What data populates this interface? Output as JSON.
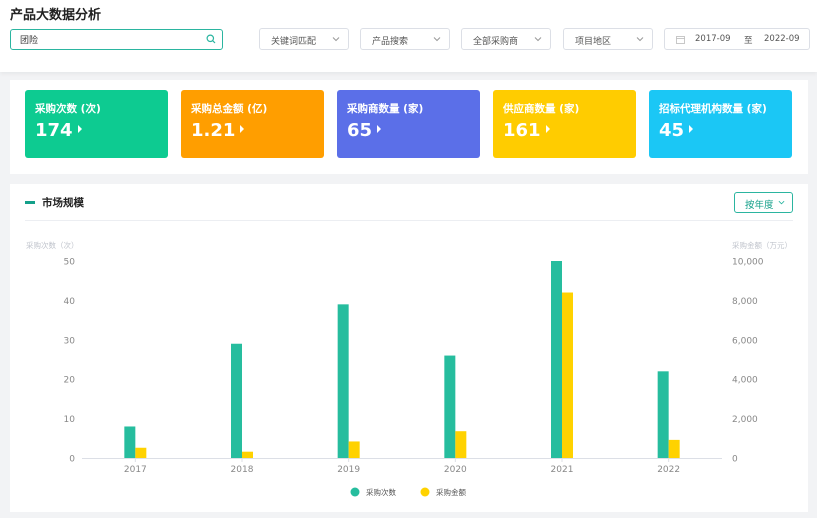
{
  "header": {
    "title": "产品大数据分析",
    "search": {
      "value": "团险",
      "placeholder": ""
    },
    "filters": [
      {
        "label": "关键词匹配"
      },
      {
        "label": "产品搜索"
      },
      {
        "label": "全部采购商"
      },
      {
        "label": "项目地区"
      }
    ],
    "date_range": {
      "start": "2017-09",
      "separator": "至",
      "end": "2022-09"
    }
  },
  "stats": [
    {
      "label": "采购次数 (次)",
      "value": "174",
      "color": "#0dcb91"
    },
    {
      "label": "采购总金额 (亿)",
      "value": "1.21",
      "color": "#ff9e00"
    },
    {
      "label": "采购商数量 (家)",
      "value": "65",
      "color": "#5b6fe8"
    },
    {
      "label": "供应商数量 (家)",
      "value": "161",
      "color": "#ffcc00"
    },
    {
      "label": "招标代理机构数量 (家)",
      "value": "45",
      "color": "#1bc7f5"
    }
  ],
  "market": {
    "title": "市场规模",
    "year_select": "按年度"
  },
  "chart_data": {
    "type": "bar",
    "categories": [
      "2017",
      "2018",
      "2019",
      "2020",
      "2021",
      "2022"
    ],
    "ylabel": "采购次数（次）",
    "y2label": "采购金额（万元）",
    "ylim": [
      0,
      50
    ],
    "y2lim": [
      0,
      10000
    ],
    "yticks": [
      "0",
      "10",
      "20",
      "30",
      "40",
      "50"
    ],
    "y2ticks": [
      "0",
      "2,000",
      "4,000",
      "6,000",
      "8,000",
      "10,000"
    ],
    "legend_position": "bottom-center",
    "grid": false,
    "series": [
      {
        "name": "采购次数",
        "axis": "left",
        "color": "#26bd9e",
        "values": [
          8,
          29,
          39,
          26,
          50,
          22
        ]
      },
      {
        "name": "采购金额",
        "axis": "right",
        "color": "#ffd200",
        "values": [
          520,
          320,
          840,
          1360,
          8400,
          920
        ]
      }
    ]
  }
}
